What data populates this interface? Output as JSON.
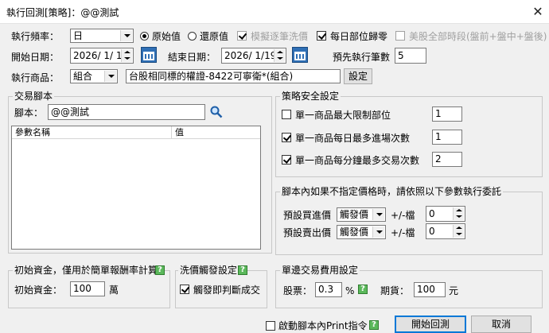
{
  "window": {
    "title": "執行回測[策略]：@@測試",
    "close_glyph": "✕"
  },
  "top": {
    "freq_label": "執行頻率：",
    "freq_value": "日",
    "radio_original": "原始值",
    "radio_restore": "還原值",
    "chk_simulate": "模擬逐筆洗價",
    "chk_daily_reset": "每日部位歸零",
    "chk_us_all_sessions": "美股全部時段(盤前+盤中+盤後)",
    "start_label": "開始日期：",
    "start_value": "2026/ 1/ 1",
    "end_label": "結束日期：",
    "end_value": "2026/ 1/19",
    "expected_label": "預先執行筆數",
    "expected_value": "5",
    "product_label": "執行商品：",
    "product_type": "組合",
    "product_desc": "台股相同標的權證-8422可寧衛*(組合)",
    "setting_button": "設定"
  },
  "script_group": {
    "title": "交易腳本",
    "script_label": "腳本：",
    "script_value": "@@測試",
    "col_param": "參數名稱",
    "col_value": "值"
  },
  "strategy_safety": {
    "title": "策略安全設定",
    "item1_label": "單一商品最大限制部位",
    "item1_value": "1",
    "item2_label": "單一商品每日最多進場次數",
    "item2_value": "1",
    "item3_label": "單一商品每分鐘最多交易次數",
    "item3_value": "2"
  },
  "price_group": {
    "title": "腳本內如果不指定價格時，請依照以下參數執行委託",
    "buy_label": "預設買進價",
    "buy_value": "觸發價",
    "buy_tick_label": "+/-檔",
    "buy_tick": "0",
    "sell_label": "預設賣出價",
    "sell_value": "觸發價",
    "sell_tick_label": "+/-檔",
    "sell_tick": "0"
  },
  "capital_group": {
    "title": "初始資金，僅用於簡單報酬率計算",
    "label": "初始資金：",
    "value": "100",
    "unit": "萬"
  },
  "wash_group": {
    "title": "洗價觸發設定",
    "chk_label": "觸發即判斷成交"
  },
  "fee_group": {
    "title": "單邊交易費用設定",
    "stock_label": "股票：",
    "stock_value": "0.3",
    "stock_unit": "%",
    "futures_label": "期貨：",
    "futures_value": "100",
    "futures_unit": "元"
  },
  "bottom": {
    "print_chk": "啟動腳本內Print指令",
    "start_button": "開始回測",
    "cancel_button": "取消"
  },
  "help_glyph": "?"
}
